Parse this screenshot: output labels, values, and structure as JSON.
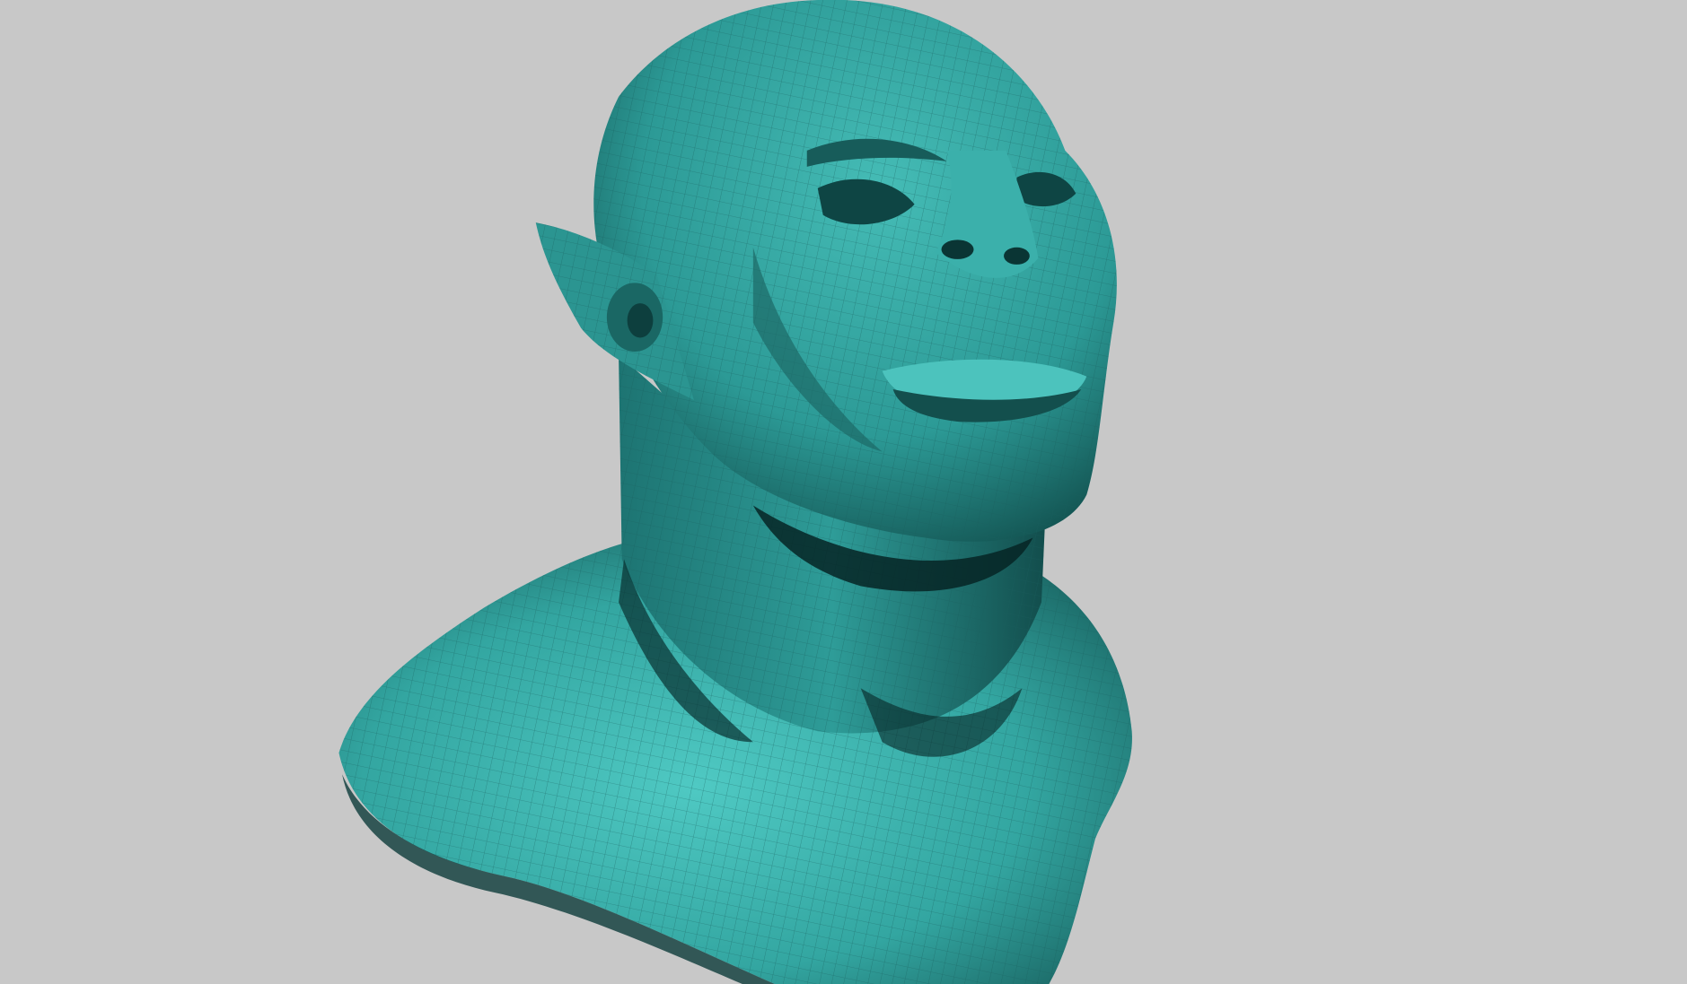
{
  "scene": {
    "subject": "sculpted-bust",
    "colors": {
      "background": "#c8c8c8",
      "surface_light": "#4fc9c3",
      "surface_mid": "#2fa19d",
      "surface_dark": "#0f4a49",
      "shadow": "#062524",
      "wire": "#1e6f6c"
    }
  }
}
